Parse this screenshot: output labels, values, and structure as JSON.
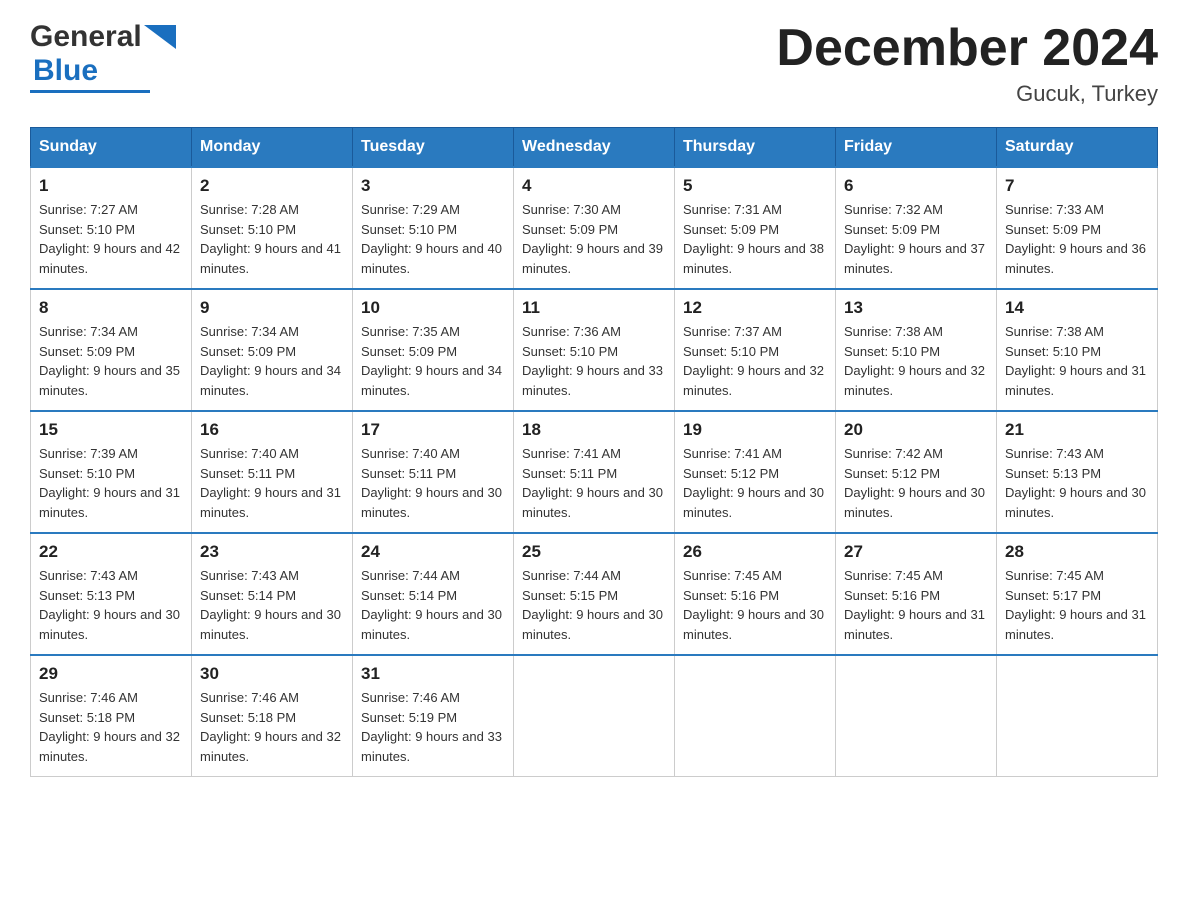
{
  "header": {
    "logo_general": "General",
    "logo_blue": "Blue",
    "month_title": "December 2024",
    "location": "Gucuk, Turkey"
  },
  "days_of_week": [
    "Sunday",
    "Monday",
    "Tuesday",
    "Wednesday",
    "Thursday",
    "Friday",
    "Saturday"
  ],
  "weeks": [
    [
      {
        "num": "1",
        "sunrise": "7:27 AM",
        "sunset": "5:10 PM",
        "daylight": "9 hours and 42 minutes."
      },
      {
        "num": "2",
        "sunrise": "7:28 AM",
        "sunset": "5:10 PM",
        "daylight": "9 hours and 41 minutes."
      },
      {
        "num": "3",
        "sunrise": "7:29 AM",
        "sunset": "5:10 PM",
        "daylight": "9 hours and 40 minutes."
      },
      {
        "num": "4",
        "sunrise": "7:30 AM",
        "sunset": "5:09 PM",
        "daylight": "9 hours and 39 minutes."
      },
      {
        "num": "5",
        "sunrise": "7:31 AM",
        "sunset": "5:09 PM",
        "daylight": "9 hours and 38 minutes."
      },
      {
        "num": "6",
        "sunrise": "7:32 AM",
        "sunset": "5:09 PM",
        "daylight": "9 hours and 37 minutes."
      },
      {
        "num": "7",
        "sunrise": "7:33 AM",
        "sunset": "5:09 PM",
        "daylight": "9 hours and 36 minutes."
      }
    ],
    [
      {
        "num": "8",
        "sunrise": "7:34 AM",
        "sunset": "5:09 PM",
        "daylight": "9 hours and 35 minutes."
      },
      {
        "num": "9",
        "sunrise": "7:34 AM",
        "sunset": "5:09 PM",
        "daylight": "9 hours and 34 minutes."
      },
      {
        "num": "10",
        "sunrise": "7:35 AM",
        "sunset": "5:09 PM",
        "daylight": "9 hours and 34 minutes."
      },
      {
        "num": "11",
        "sunrise": "7:36 AM",
        "sunset": "5:10 PM",
        "daylight": "9 hours and 33 minutes."
      },
      {
        "num": "12",
        "sunrise": "7:37 AM",
        "sunset": "5:10 PM",
        "daylight": "9 hours and 32 minutes."
      },
      {
        "num": "13",
        "sunrise": "7:38 AM",
        "sunset": "5:10 PM",
        "daylight": "9 hours and 32 minutes."
      },
      {
        "num": "14",
        "sunrise": "7:38 AM",
        "sunset": "5:10 PM",
        "daylight": "9 hours and 31 minutes."
      }
    ],
    [
      {
        "num": "15",
        "sunrise": "7:39 AM",
        "sunset": "5:10 PM",
        "daylight": "9 hours and 31 minutes."
      },
      {
        "num": "16",
        "sunrise": "7:40 AM",
        "sunset": "5:11 PM",
        "daylight": "9 hours and 31 minutes."
      },
      {
        "num": "17",
        "sunrise": "7:40 AM",
        "sunset": "5:11 PM",
        "daylight": "9 hours and 30 minutes."
      },
      {
        "num": "18",
        "sunrise": "7:41 AM",
        "sunset": "5:11 PM",
        "daylight": "9 hours and 30 minutes."
      },
      {
        "num": "19",
        "sunrise": "7:41 AM",
        "sunset": "5:12 PM",
        "daylight": "9 hours and 30 minutes."
      },
      {
        "num": "20",
        "sunrise": "7:42 AM",
        "sunset": "5:12 PM",
        "daylight": "9 hours and 30 minutes."
      },
      {
        "num": "21",
        "sunrise": "7:43 AM",
        "sunset": "5:13 PM",
        "daylight": "9 hours and 30 minutes."
      }
    ],
    [
      {
        "num": "22",
        "sunrise": "7:43 AM",
        "sunset": "5:13 PM",
        "daylight": "9 hours and 30 minutes."
      },
      {
        "num": "23",
        "sunrise": "7:43 AM",
        "sunset": "5:14 PM",
        "daylight": "9 hours and 30 minutes."
      },
      {
        "num": "24",
        "sunrise": "7:44 AM",
        "sunset": "5:14 PM",
        "daylight": "9 hours and 30 minutes."
      },
      {
        "num": "25",
        "sunrise": "7:44 AM",
        "sunset": "5:15 PM",
        "daylight": "9 hours and 30 minutes."
      },
      {
        "num": "26",
        "sunrise": "7:45 AM",
        "sunset": "5:16 PM",
        "daylight": "9 hours and 30 minutes."
      },
      {
        "num": "27",
        "sunrise": "7:45 AM",
        "sunset": "5:16 PM",
        "daylight": "9 hours and 31 minutes."
      },
      {
        "num": "28",
        "sunrise": "7:45 AM",
        "sunset": "5:17 PM",
        "daylight": "9 hours and 31 minutes."
      }
    ],
    [
      {
        "num": "29",
        "sunrise": "7:46 AM",
        "sunset": "5:18 PM",
        "daylight": "9 hours and 32 minutes."
      },
      {
        "num": "30",
        "sunrise": "7:46 AM",
        "sunset": "5:18 PM",
        "daylight": "9 hours and 32 minutes."
      },
      {
        "num": "31",
        "sunrise": "7:46 AM",
        "sunset": "5:19 PM",
        "daylight": "9 hours and 33 minutes."
      },
      null,
      null,
      null,
      null
    ]
  ]
}
